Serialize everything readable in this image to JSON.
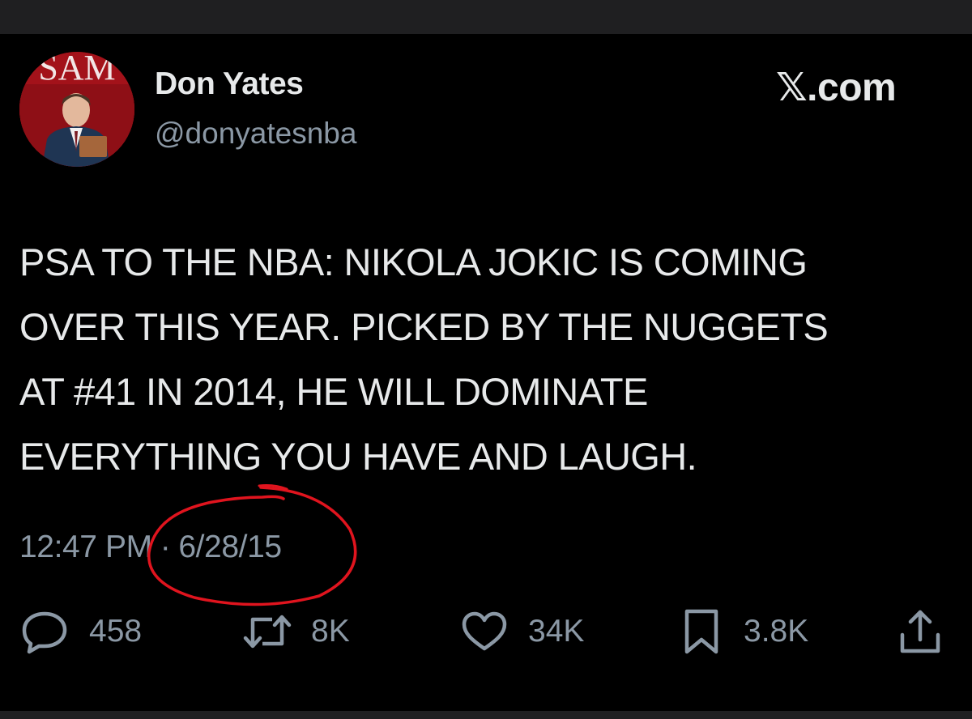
{
  "author": {
    "avatar_text": "SAM",
    "name": "Don Yates",
    "handle": "@donyatesnba"
  },
  "brand": "𝕏.com",
  "tweet": {
    "lines": [
      "PSA TO THE NBA: NIKOLA JOKIC IS COMING",
      "OVER THIS YEAR. PICKED BY THE NUGGETS",
      "AT #41 IN 2014, HE WILL DOMINATE",
      "EVERYTHING YOU HAVE AND LAUGH."
    ]
  },
  "meta": {
    "time": "12:47 PM",
    "separator": "·",
    "date": "6/28/15"
  },
  "actions": {
    "replies": "458",
    "retweets": "8K",
    "likes": "34K",
    "bookmarks": "3.8K"
  },
  "icons": {
    "reply": "speech-bubble-icon",
    "retweet": "retweet-arrows-icon",
    "like": "heart-icon",
    "bookmark": "bookmark-icon",
    "share": "share-upload-icon"
  },
  "colors": {
    "background": "#000000",
    "text": "#e7e9ea",
    "secondary": "#8b98a5",
    "annotation": "#e0141e"
  }
}
